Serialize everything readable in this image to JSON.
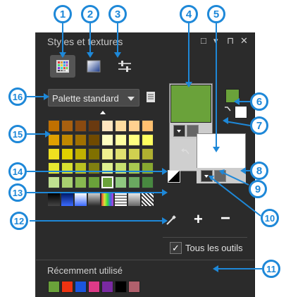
{
  "panel": {
    "title": "Styles et textures",
    "window_controls": [
      "□",
      "▾",
      "⊓",
      "✕"
    ],
    "tabs": [
      {
        "name": "tab-color",
        "icon": "color-grid-icon",
        "active": true
      },
      {
        "name": "tab-gradient",
        "icon": "gradient-icon",
        "active": false
      },
      {
        "name": "tab-adjust",
        "icon": "adjust-sliders-icon",
        "active": false
      }
    ],
    "palette_dropdown": {
      "label": "Palette standard"
    },
    "all_tools_checkbox": {
      "label": "Tous les outils",
      "checked": true
    },
    "recent_label": "Récemment utilisé",
    "recent_colors": [
      "#6aa23a",
      "#ee3311",
      "#1a55dd",
      "#dd3a88",
      "#7a2aa2",
      "#000000",
      "#b0606c"
    ],
    "foreground_color": "#6aa23a",
    "background_color": "#ffffff",
    "palette_rows": [
      [
        "#c07000",
        "#a86010",
        "#8a4a10",
        "#6a3a10",
        "#ffe6c0",
        "#ffdca0",
        "#ffd090",
        "#ffc070"
      ],
      [
        "#e0a000",
        "#c08800",
        "#a07000",
        "#704a00",
        "#ffffc0",
        "#ffffa0",
        "#ffff80",
        "#ffff60"
      ],
      [
        "#f0e020",
        "#e0d000",
        "#c0b000",
        "#807000",
        "#f0f090",
        "#e0e070",
        "#d0d050",
        "#b0b030"
      ],
      [
        "#e8e830",
        "#d8e030",
        "#b8c020",
        "#808010",
        "#e0f090",
        "#c8e070",
        "#a8c850",
        "#88a830"
      ],
      [
        "#c0e090",
        "#a8d070",
        "#88b850",
        "#6aa23a",
        "#b8e0a8",
        "#90c880",
        "#6aa860",
        "#488840"
      ]
    ],
    "callouts": [
      "1",
      "2",
      "3",
      "4",
      "5",
      "6",
      "7",
      "8",
      "9",
      "10",
      "11",
      "12",
      "13",
      "14",
      "15",
      "16"
    ]
  }
}
